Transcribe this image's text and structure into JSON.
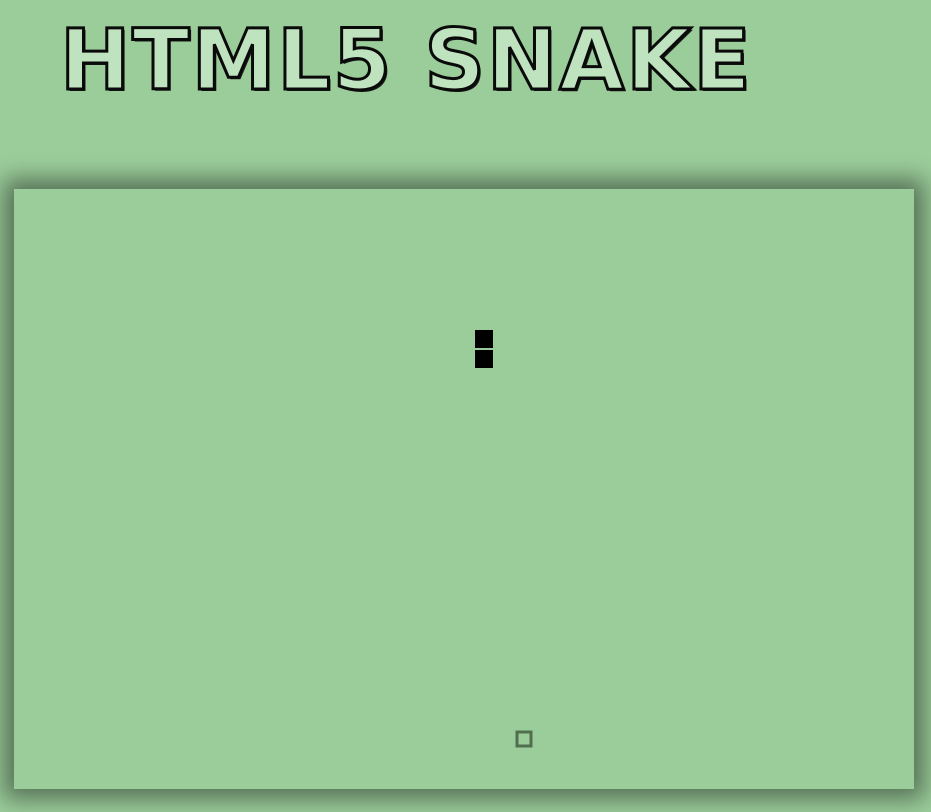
{
  "header": {
    "title": "HTML5 SNAKE"
  },
  "board": {
    "grid_columns": 45,
    "grid_rows": 30,
    "background": "#9bcd9b",
    "snake_color": "#000000",
    "food_color": "#4f6f4f"
  },
  "snake": {
    "segments": [
      {
        "col": 23,
        "row": 7
      },
      {
        "col": 23,
        "row": 8
      }
    ]
  },
  "food": {
    "col": 25,
    "row": 27
  }
}
